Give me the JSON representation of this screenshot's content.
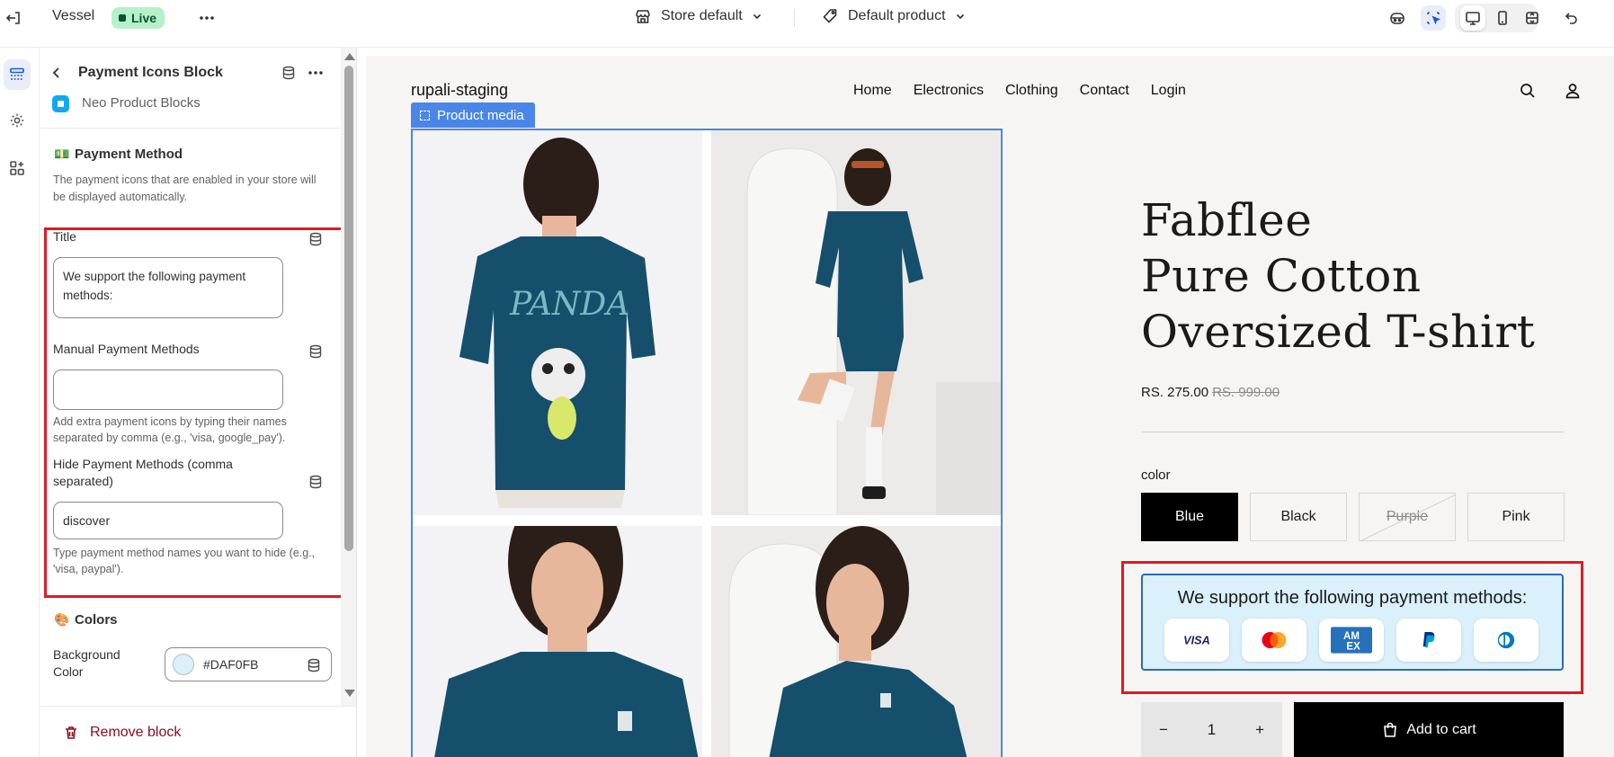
{
  "topbar": {
    "theme_name": "Vessel",
    "status": "Live",
    "store_selector": "Store default",
    "template_selector": "Default product"
  },
  "panel": {
    "block_title": "Payment Icons Block",
    "app_name": "Neo Product Blocks",
    "payment_section": {
      "heading": "Payment Method",
      "description": "The payment icons that are enabled in your store will be displayed automatically."
    },
    "fields": {
      "title_label": "Title",
      "title_value": "We support the following payment methods:",
      "manual_label": "Manual Payment Methods",
      "manual_value": "",
      "manual_help": "Add extra payment icons by typing their names separated by comma (e.g., 'visa, google_pay').",
      "hide_label": "Hide Payment Methods (comma separated)",
      "hide_value": "discover",
      "hide_help": "Type payment method names you want to hide (e.g., 'visa, paypal')."
    },
    "colors_section": {
      "heading": "Colors",
      "bg_label": "Background Color",
      "bg_value": "#DAF0FB",
      "bg_swatch": "#DAF0FB",
      "text_swatch": "#000000"
    },
    "remove_label": "Remove block"
  },
  "preview": {
    "store_name": "rupali-staging",
    "nav": [
      "Home",
      "Electronics",
      "Clothing",
      "Contact",
      "Login"
    ],
    "media_tag": "Product media",
    "product_title_lines": [
      "Fabflee",
      "Pure Cotton",
      "Oversized T-shirt"
    ],
    "price": "RS. 275.00",
    "compare_price": "RS. 999.00",
    "option_label": "color",
    "variants": [
      {
        "label": "Blue",
        "state": "selected"
      },
      {
        "label": "Black",
        "state": "available"
      },
      {
        "label": "Purple",
        "state": "unavailable"
      },
      {
        "label": "Pink",
        "state": "available"
      }
    ],
    "payment_block": {
      "title": "We support the following payment methods:",
      "icons": [
        "visa-icon",
        "mastercard-icon",
        "amex-icon",
        "paypal-icon",
        "diners-club-icon"
      ]
    },
    "quantity": "1",
    "add_to_cart": "Add to cart"
  },
  "colors": {
    "accent_blue": "#1A5AD6",
    "highlight_red": "#E01B22",
    "live_green": "#B5F1C8",
    "media_blue": "#4A86E8",
    "tshirt_teal": "#134E6F"
  }
}
